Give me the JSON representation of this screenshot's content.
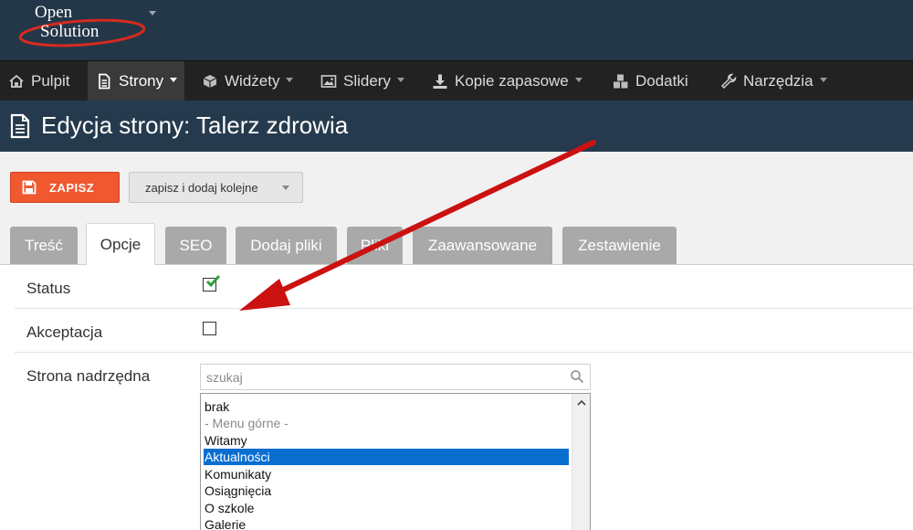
{
  "brand": {
    "logo_text_1": "Open",
    "logo_text_2": "Solution"
  },
  "nav": {
    "items": [
      {
        "label": "Pulpit"
      },
      {
        "label": "Strony"
      },
      {
        "label": "Widżety"
      },
      {
        "label": "Slidery"
      },
      {
        "label": "Kopie zapasowe"
      },
      {
        "label": "Dodatki"
      },
      {
        "label": "Narzędzia"
      }
    ]
  },
  "page": {
    "title": "Edycja strony: Talerz zdrowia"
  },
  "toolbar": {
    "save_label": "ZAPISZ",
    "save_more_label": "zapisz i dodaj kolejne"
  },
  "tabs": [
    {
      "label": "Treść"
    },
    {
      "label": "Opcje"
    },
    {
      "label": "SEO"
    },
    {
      "label": "Dodaj pliki"
    },
    {
      "label": "Pliki"
    },
    {
      "label": "Zaawansowane"
    },
    {
      "label": "Zestawienie"
    }
  ],
  "form": {
    "status_label": "Status",
    "status_checked": true,
    "acceptance_label": "Akceptacja",
    "acceptance_checked": false,
    "parent_label": "Strona nadrzędna",
    "search_placeholder": "szukaj",
    "options": [
      "brak",
      "- Menu górne -",
      "Witamy",
      "Aktualności",
      "Komunikaty",
      "Osiągnięcia",
      "O szkole",
      "Galerie"
    ],
    "selected_option": "Aktualności"
  },
  "colors": {
    "topbar": "#243748",
    "nav": "#222222",
    "titlebar": "#253a4d",
    "save_button": "#f0582f",
    "selection": "#0a6ed1",
    "annotation_arrow": "#cc1111",
    "check_green": "#2e9e3a"
  },
  "icons": {
    "home": "home-icon",
    "page": "document-icon",
    "widgets": "cube-icon",
    "sliders": "image-icon",
    "backup": "download-icon",
    "addons": "cubes-icon",
    "tools": "wrench-icon",
    "save": "floppy-icon",
    "search": "search-icon"
  }
}
